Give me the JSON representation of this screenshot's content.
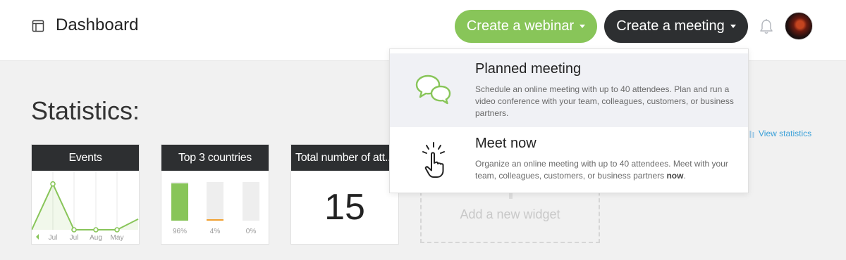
{
  "header": {
    "title": "Dashboard",
    "create_webinar_label": "Create a webinar",
    "create_meeting_label": "Create a meeting"
  },
  "statistics": {
    "title": "Statistics:",
    "view_statistics_label": "View statistics"
  },
  "widgets": {
    "events": {
      "title": "Events",
      "chart_data": {
        "type": "line",
        "categories": [
          "",
          "Jul",
          "Jul",
          "Aug",
          "May",
          ""
        ],
        "x_tick_labels": [
          "Jul",
          "Jul",
          "Aug",
          "May"
        ],
        "values": [
          0,
          3,
          0,
          0,
          0,
          0.7
        ],
        "ylim": [
          0,
          3.4
        ],
        "markers": [
          false,
          true,
          true,
          true,
          true,
          false
        ],
        "color": "#88c559"
      }
    },
    "countries": {
      "title": "Top 3 countries",
      "chart_data": {
        "type": "bar",
        "categories": [
          "",
          "",
          ""
        ],
        "values": [
          96,
          4,
          0
        ],
        "labels": [
          "96%",
          "4%",
          "0%"
        ],
        "colors": [
          "#88c559",
          "#f0a030",
          "#cccccc"
        ],
        "ylim": [
          0,
          100
        ]
      }
    },
    "total": {
      "title": "Total number of att...",
      "value": "15"
    },
    "add": {
      "label": "Add a new widget"
    }
  },
  "dropdown": {
    "items": [
      {
        "title": "Planned meeting",
        "description": "Schedule an online meeting with up to 40 attendees. Plan and run a video conference with your team, colleagues, customers, or business partners.",
        "icon": "chat-bubbles-icon"
      },
      {
        "title": "Meet now",
        "description_prefix": "Organize an online meeting with up to 40 attendees. Meet with your team, colleagues, customers, or business partners ",
        "description_bold": "now",
        "description_suffix": ".",
        "icon": "hand-pointer-icon"
      }
    ]
  },
  "colors": {
    "green": "#88c559",
    "dark": "#2d2f31",
    "link": "#3aa0d8"
  }
}
